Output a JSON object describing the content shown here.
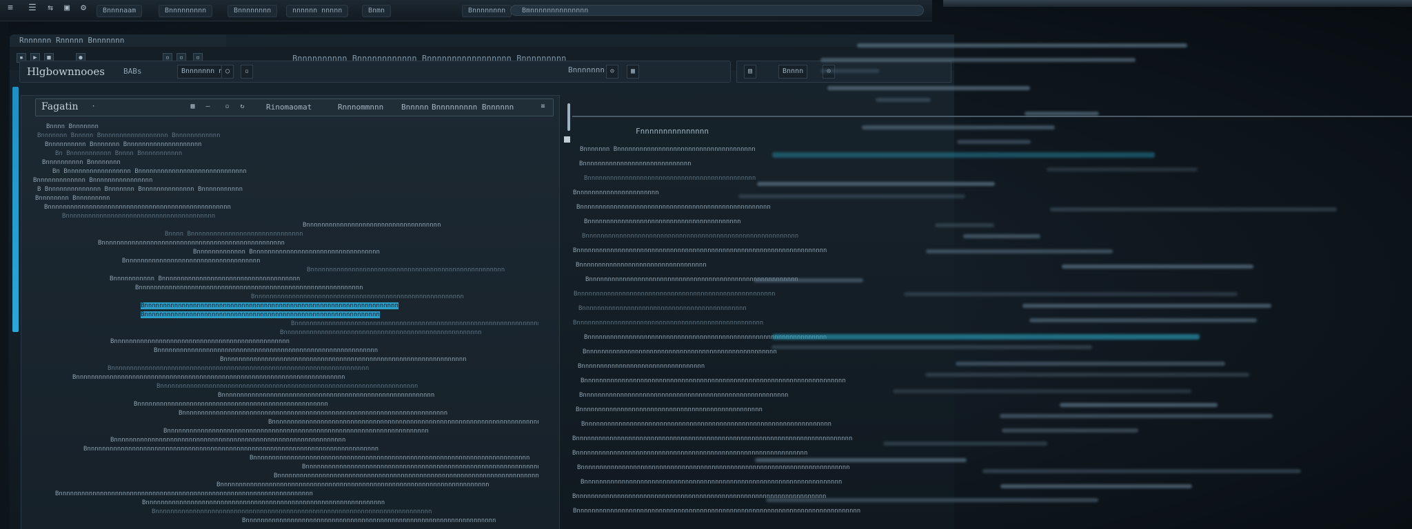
{
  "os_bar": {
    "tabs": [
      "Bnnnnaam",
      "Bnnnnnnnnn",
      "Bnnnnnnnn",
      "nnnnnn nnnnn",
      "Bnmn",
      "Bnnnnnnnn"
    ],
    "search_text": "Bmnnnnnnnnnnnnnn"
  },
  "ide": {
    "window_title": "Rnnnnnn   Rnnnnn   Bnnnnnnn",
    "menu_text": "Bnnnnnnnnnn Bnnnnnnnnnnnn Bnnnnnnnnnnnnnnnnn Bnnnnnnnnn",
    "address": {
      "text": "Hlgbownnooes",
      "subtitle": "BABs",
      "field_label": "Bnnnnnnn n",
      "status": "Bnnnnnnn",
      "side_label": "Bnnnn"
    }
  },
  "left_pane": {
    "title": "Fagatin",
    "header_labels": [
      "Rinomaomat",
      "Rnnnommnnn",
      "Bnnnnn",
      "Bnnnnnnnnn Bnnnnnn"
    ],
    "lines": [
      "Bnnnn  Bnnnnnnn",
      "Bnnnnnnn  Bnnnnn  Bnnnnnnnnnnnnnnnnnn  Bnnnnnnnnnnnn",
      "Bnnnnnnnnnn  Bnnnnnnn  Bnnnnnnnnnnnnnnnnnnnn",
      "Bn  Bnnnnnnnnnnn  Bnnnn  Bnnnnnnnnnnn",
      "Bnnnnnnnnnn  Bnnnnnnnn",
      "Bn  Bnnnnnnnnnnnnnnnnn  Bnnnnnnnnnnnnnnnnnnnnnnnnnnnnn",
      "Bnnnnnnnnnnnnn  Bnnnnnnnnnnnnnnnn",
      "B  Bnnnnnnnnnnnnnn  Bnnnnnnn  Bnnnnnnnnnnnnnn  Bnnnnnnnnnnn",
      "Bnnnnnnnn  Bnnnnnnnnn",
      "Bnnnnnnnnnnnnnnnnnnnnnnnnnnnnnnnnnnnnnnnnnnnnnnnnn",
      "Bnnnnnnnnnnnnnnnnnnnnnnnnnnnnnnnnnnnnnnnn",
      "Bnnnnnnnnnnnnnnnnnnnnnnnnnnnnnnnnnnnn",
      "Bnnnn  Bnnnnnnnnnnnnnnnnnnnnnnnnnnnnnn",
      "Bnnnnnnnnnnnnnnnnnnnnnnnnnnnnnnnnnnnnnnnnnnnnnnnnn",
      "Bnnnnnnnnnnnnn  Bnnnnnnnnnnnnnnnnnnnnnnnnnnnnnnnnnn",
      "Bnnnnnnnnnnnnnnnnnnnnnnnnnnnnnnnnnnnn",
      "Bnnnnnnnnnnnnnnnnnnnnnnnnnnnnnnnnnnnnnnnnnnnnnnnnnnnn",
      "Bnnnnnnnnnnn  Bnnnnnnnnnnnnnnnnnnnnnnnnnnnnnnnnnnnnn",
      "Bnnnnnnnnnnnnnnnnnnnnnnnnnnnnnnnnnnnnnnnnnnnnnnnnnnnnnnnnnnnn",
      "Bnnnnnnnnnnnnnnnnnnnnnnnnnnnnnnnnnnnnnnnnnnnnnnnnnnnnnnnn",
      "Bnnnnnnnnnnnnnnnnnnnnnnnnnnnnnnnnnnnnnnnnnnnnnnnnnnnnnnnnnnnnnnnnnnnn",
      "Bnnnnnnnnnnnnnnnnnnnnnnnnnnnnnnnnnnnnnnnnnnnnnnnnnnnnnnnnnnnnnnn",
      "Bnnnnnnnnnnnnnnnnnnnnnnnnnnnnnnnnnnnnnnnnnnnnnnnnnnnnnnnnnnnnnnnnnnnnnnnn",
      "Bnnnnnnnnnnnnnnnnnnnnnnnnnnnnnnnnnnnnnnnnnnnnnnnnnnnnn",
      "Bnnnnnnnnnnnnnnnnnnnnnnnnnnnnnnnnnnnnnnnnnnnnnnn",
      "Bnnnnnnnnnnnnnnnnnnnnnnnnnnnnnnnnnnnnnnnnnnnnnnnnnnnnnnnnnnn",
      "Bnnnnnnnnnnnnnnnnnnnnnnnnnnnnnnnnnnnnnnnnnnnnnnnnnnnnnnnnnnnnnnnnn",
      "Bnnnnnnnnnnnnnnnnnnnnnnnnnnnnnnnnnnnnnnnnnnnnnnnnnnnnnnnnnnnnnnnnnnnnn",
      "Bnnnnnnnnnnnnnnnnnnnnnnnnnnnnnnnnnnnnnnnnnnnnnnnnnnnnnnnnnnnnnnnnnnnnnnnn",
      "Bnnnnnnnnnnnnnnnnnnnnnnnnnnnnnnnnnnnnnnnnnnnnnnnnnnnnnnnnnnnnnnnnnnnnn",
      "Bnnnnnnnnnnnnnnnnnnnnnnnnnnnnnnnnnnnnnnnnnnnnnnnnnnnnnnnnn",
      "Bnnnnnnnnnnnnnnnnnnnnnnnnnnnnnnnnnnnnnnnnnnnnnnnnnnn",
      "Bnnnnnnnnnnnnnnnnnnnnnnnnnnnnnnnnnnnnnnnnnnnnnnnnnnnnnnnnnnnnnnnnnnnnnnn",
      "Bnnnnnnnnnnnnnnnnnnnnnnnnnnnnnnnnnnnnnnnnnnnnnnnnnnnnnnnnnnnnnnnnnnnnnnnnn",
      "Bnnnnnnnnnnnnnnnnnnnnnnnnnnnnnnnnnnnnnnnnnnnnnnnnnnnnnnnnnnnnnnnnnnnnnn",
      "Bnnnnnnnnnnnnnnnnnnnnnnnnnnnnnnnnnnnnnnnnnnnnnnnnnnnnnnnnnnnnnn",
      "Bnnnnnnnnnnnnnnnnnnnnnnnnnnnnnnnnnnnnnnnnnnnnnnnnnnnnnnnnnnnnnnnnnnnnnnnnnnnnnn",
      "Bnnnnnnnnnnnnnnnnnnnnnnnnnnnnnnnnnnnnnnnnnnnnnnnnnnnnnnnnnnnnnnnnnnnnnnnnnn",
      "Bnnnnnnnnnnnnnnnnnnnnnnnnnnnnnnnnnnnnnnnnnnnnnnnnnnnnnnnnnnnnnnnnnnnnnn",
      "Bnnnnnnnnnnnnnnnnnnnnnnnnnnnnnnnnnnnnnnnnnnnnnnnnnnnnnnnnnnnnnnnnnnnnnnnnnnnn",
      "Bnnnnnnnnnnnnnnnnnnnnnnnnnnnnnnnnnnnnnnnnnnnnnnnnnnnnnnnnnnnnnnnnnnnnnnnn",
      "Bnnnnnnnnnnnnnnnnnnnnnnnnnnnnnnnnnnnnnnnnnnnnnnnnnnnnnnnnnnnnnnnnnnnn",
      "Bnnnnnnnnnnnnnnnnnnnnnnnnnnnnnnnnnnnnnnnnnnnnnnnnnnnnnnnnnnnnnnnn",
      "Bnnnnnnnnnnnnnnnnnnnnnnnnnnnnnnnnnnnnnnnnnnnnnnnnnnnnnnnnnnnnnnnnnnnnnnnnnn",
      "Bnnnnnnnnnnnnnnnnnnnnnnnnnnnnnnnnnnnnnnnnnnnnnnnnnnnnnnnnnnnnnnnnnnn"
    ]
  },
  "right_pane": {
    "title": "Fnnnnnnnnnnnnnnn",
    "lines": [
      "Bnnnnnnn  Bnnnnnnnnnnnnnnnnnnnnnnnnnnnnnnnnnnnnn",
      "Bnnnnnnnnnnnnnnnnnnnnnnnnnnnnn",
      "Bnnnnnnnnnnnnnnnnnnnnnnnnnnnnnnnnnnnnnnnnnnnnn",
      "Bnnnnnnnnnnnnnnnnnnnnnn",
      "Bnnnnnnnnnnnnnnnnnnnnnnnnnnnnnnnnnnnnnnnnnnnnnnnnnnn",
      "Bnnnnnnnnnnnnnnnnnnnnnnnnnnnnnnnnnnnnnnnnn",
      "Bnnnnnnnnnnnnnnnnnnnnnnnnnnnnnnnnnnnnnnnnnnnnnnnnnnnnnnnnn",
      "Bnnnnnnnnnnnnnnnnnnnnnnnnnnnnnnnnnnnnnnnnnnnnnnnnnnnnnnnnnnnnnnnnnnn",
      "Bnnnnnnnnnnnnnnnnnnnnnnnnnnnnnnnnnn",
      "Bnnnnnnnnnnnnnnnnnnnnnnnnnnnnnnnnnnnnnnnnnnnnnnnnnnnnnnnn",
      "Bnnnnnnnnnnnnnnnnnnnnnnnnnnnnnnnnnnnnnnnnnnnnnnnnnnnnn",
      "Bnnnnnnnnnnnnnnnnnnnnnnnnnnnnnnnnnnnnnnnnnnnn",
      "Bnnnnnnnnnnnnnnnnnnnnnnnnnnnnnnnnnnnnnnnnnnnnnnnnnn",
      "Bnnnnnnnnnnnnnnnnnnnnnnnnnnnnnnnnnnnnnnnnnnnnnnnnnnnnnnnnnnnnnnnn",
      "Bnnnnnnnnnnnnnnnnnnnnnnnnnnnnnnnnnnnnnnnnnnnnnnnnnnn",
      "Bnnnnnnnnnnnnnnnnnnnnnnnnnnnnnnnnn",
      "Bnnnnnnnnnnnnnnnnnnnnnnnnnnnnnnnnnnnnnnnnnnnnnnnnnnnnnnnnnnnnnnnnnnnnnn",
      "Bnnnnnnnnnnnnnnnnnnnnnnnnnnnnnnnnnnnnnnnnnnnnnnnnnnnnnnn",
      "Bnnnnnnnnnnnnnnnnnnnnnnnnnnnnnnnnnnnnnnnnnnnnnnnnn",
      "Bnnnnnnnnnnnnnnnnnnnnnnnnnnnnnnnnnnnnnnnnnnnnnnnnnnnnnnnnnnnnnnnnnn",
      "Bnnnnnnnnnnnnnnnnnnnnnnnnnnnnnnnnnnnnnnnnnnnnnnnnnnnnnnnnnnnnnnnnnnnnnnnnnn",
      "Bnnnnnnnnnnnnnnnnnnnnnnnnnnnnnnnnnnnnnnnnnnnnnnnnnnnnnnnnnnnnnn",
      "Bnnnnnnnnnnnnnnnnnnnnnnnnnnnnnnnnnnnnnnnnnnnnnnnnnnnnnnnnnnnnnnnnnnnnnnnn",
      "Bnnnnnnnnnnnnnnnnnnnnnnnnnnnnnnnnnnnnnnnnnnnnnnnnnnnnnnnnnnnnnnnnnnnnn",
      "Bnnnnnnnnnnnnnnnnnnnnnnnnnnnnnnnnnnnnnnnnnnnnnnnnnnnnnnnnnnnnnnnnnnn",
      "Bnnnnnnnnnnnnnnnnnnnnnnnnnnnnnnnnnnnnnnnnnnnnnnnnnnnnnnnnnnnnnnnnnnnnnnnnnnnn"
    ]
  },
  "colors": {
    "accent": "#2aa8d8",
    "highlight": "#2c9fc9",
    "background": "#0b1218"
  }
}
